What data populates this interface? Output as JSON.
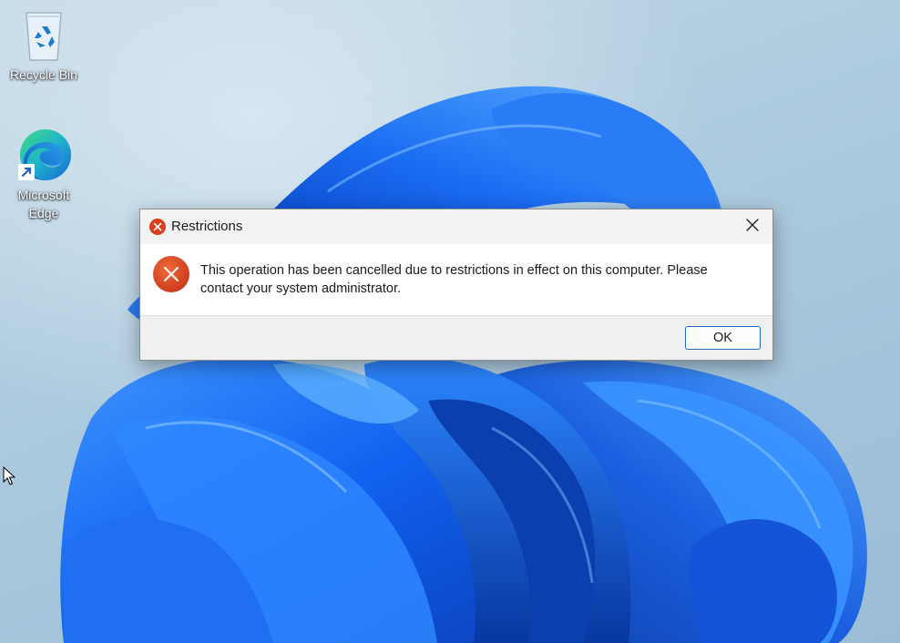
{
  "desktop": {
    "icons": [
      {
        "label": "Recycle Bin",
        "icon": "recycle-bin-icon"
      },
      {
        "label": "Microsoft\nEdge",
        "label_line1": "Microsoft",
        "label_line2": "Edge",
        "icon": "edge-icon"
      }
    ]
  },
  "dialog": {
    "title": "Restrictions",
    "message": "This operation has been cancelled due to restrictions in effect on this computer. Please contact your system administrator.",
    "ok_label": "OK",
    "icons": {
      "title": "error-icon",
      "close": "close-icon",
      "body": "error-icon"
    }
  },
  "colors": {
    "error_red": "#d9411e",
    "button_border": "#1f6fc5",
    "wallpaper_blue": "#1464e8",
    "desktop_bg": "#b0cde0"
  }
}
